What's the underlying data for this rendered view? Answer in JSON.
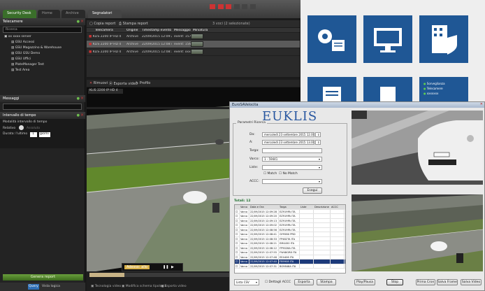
{
  "app": {
    "tabs": [
      "Security Desk",
      "Home",
      "Archive",
      "Segnalatori"
    ],
    "sidebar": {
      "tree_title": "Telecamere",
      "search_placeholder": "Ricerca",
      "tree": [
        "xx xxxx server",
        "GSU Accessi",
        "GSU Magazzino & Warehouse",
        "GSU GSU Demo",
        "GSU Uffici",
        "PlateManager Test",
        "Test Area"
      ],
      "messages_title": "Messaggi",
      "interval_title": "Intervallo di tempo",
      "interval_mode_label": "Modalità intervallo di tempo",
      "relative_label": "Relativo",
      "absolute_label": "Assoluto",
      "last_label": "Durata: l'ultimo",
      "last_value": "1",
      "unit": "giorni",
      "generate_button": "Genera report",
      "bottom_tabs": [
        "Query",
        "Vista logica"
      ]
    },
    "toolbar": {
      "left": "Copia report",
      "right": "Stampa report",
      "count": "3 voci (2 selezionate)"
    },
    "grid": {
      "headers": [
        "Telecamera",
        "Origine",
        "Timestamp evento",
        "Messaggio",
        "Miniatura"
      ],
      "rows": [
        [
          "KLIS 2200 IP HD 4",
          "Archive",
          "22/09/2015 12:09:29",
          "event: 157"
        ],
        [
          "KLIS 2200 IP HD 4",
          "Archive",
          "22/09/2015 12:08:41",
          "event: 156"
        ],
        [
          "KLIS 2200 IP HD 4",
          "Archive",
          "22/09/2015 12:08:12",
          "event: xxx"
        ]
      ]
    },
    "actions": [
      "Rimuovi",
      "Esporta video",
      "Profilo"
    ],
    "video_label": "KLIS 2200 IP HD 4",
    "video_popup": "Adesso: allo",
    "bottom_buttons": [
      "Tecnologia video",
      "Modifica schema tipologia",
      "Esporta video"
    ]
  },
  "launcher": {
    "items": [
      "Sorveglianza",
      "Telecamere",
      "xxxxxxx"
    ]
  },
  "euklis": {
    "title": "EuroSAVelocita",
    "logo": "EUKLIS",
    "group_label": "Parametri Ricerca",
    "da_label": "Da:",
    "da_value": "mercoledì 23 settembre 2015  12.00.00",
    "a_label": "A:",
    "a_value": "mercoledì 23 settembre 2015  13.00.00",
    "targa_label": "Targa:",
    "varco_label": "Varco:",
    "varco_value": "1 - 59441",
    "liste_label": "Liste:",
    "match_label": "Match",
    "nomatch_label": "No Match",
    "accc_label": "ACCC:",
    "search_button": "Esegui",
    "results_label": "Totali: 12",
    "headers": [
      "",
      "Varco",
      "Data e Ora",
      "Targa",
      "Liste",
      "Descrizione",
      "ACCC"
    ],
    "rows": [
      [
        "Varco 1",
        "22/09/2015 12:09:28",
        "EZ919PA ITA"
      ],
      [
        "Varco 1",
        "22/09/2015 12:09:20",
        "EZ919PA ITA"
      ],
      [
        "Varco 1",
        "22/09/2015 12:09:13",
        "EZ919PA ITA"
      ],
      [
        "Varco 1",
        "22/09/2015 12:09:02",
        "EZ919PA ITA"
      ],
      [
        "Varco 1",
        "22/09/2015 12:08:56",
        "EZ919PA ITA"
      ],
      [
        "Varco 1",
        "22/09/2015 12:08:41",
        "GY958X PRD"
      ],
      [
        "Varco 1",
        "22/09/2015 12:08:33",
        "FP482TA ITA"
      ],
      [
        "Varco 1",
        "22/09/2015 12:08:21",
        "EM4450 ITA"
      ],
      [
        "Varco 1",
        "22/09/2015 12:08:12",
        "FP9028A ITA"
      ],
      [
        "Varco 1",
        "22/09/2015 12:07:55",
        "FW48GR8 ITA"
      ],
      [
        "Varco 1",
        "22/09/2015 12:07:48",
        "EE4406 ITA"
      ],
      [
        "Varco 1",
        "22/09/2015 12:07:40",
        "FB9908 ITA"
      ],
      [
        "Varco 1",
        "22/09/2015 12:07:31",
        "BG9848A ITA"
      ]
    ],
    "selected_row": 11,
    "format_select": "Lista CSV",
    "dettagli_label": "Dettagli ACCC",
    "export_button": "Esporta",
    "print_button": "Stampa",
    "img_buttons": [
      "Play/Pausa",
      "Stop",
      "Prima Cron",
      "Salva Frame",
      "Salva Video"
    ]
  }
}
